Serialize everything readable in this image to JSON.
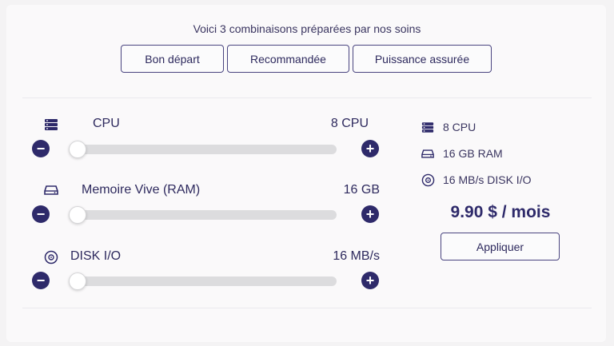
{
  "intro": "Voici 3 combinaisons préparées par nos soins",
  "presets": [
    {
      "label": "Bon départ"
    },
    {
      "label": "Recommandée"
    },
    {
      "label": "Puissance assurée"
    }
  ],
  "resources": {
    "cpu": {
      "label": "CPU",
      "value": "8 CPU",
      "level": 0.0
    },
    "ram": {
      "label": "Memoire Vive (RAM)",
      "value": "16 GB",
      "level": 0.0
    },
    "disk": {
      "label": "DISK I/O",
      "value": "16 MB/s",
      "level": 0.0
    }
  },
  "summary": {
    "cpu": "8 CPU",
    "ram": "16 GB RAM",
    "disk": "16 MB/s DISK I/O",
    "price": "9.90 $ / mois",
    "apply_label": "Appliquer"
  },
  "icons": {
    "cpu": "server-icon",
    "ram": "drive-icon",
    "disk": "disc-icon",
    "minus": "minus-icon",
    "plus": "plus-icon"
  },
  "colors": {
    "accent": "#2e2a6a",
    "text": "#2e2a5e",
    "track": "#dcdcde",
    "background": "#faf9fa"
  }
}
